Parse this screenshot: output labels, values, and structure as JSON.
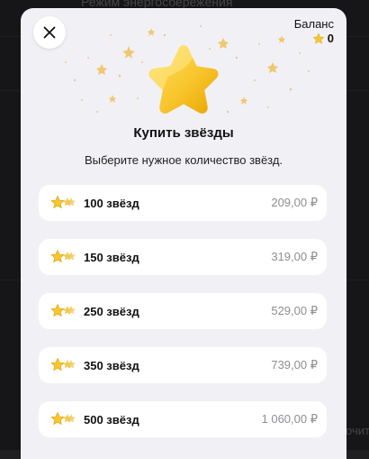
{
  "background": {
    "top_text": "Режим энергосбережения",
    "right_text": "очит"
  },
  "dialog": {
    "close_icon": "close-icon",
    "balance_label": "Баланс",
    "balance_value": "0",
    "title": "Купить звёзды",
    "subtitle": "Выберите нужное количество звёзд."
  },
  "options": [
    {
      "label": "100 звёзд",
      "price": "209,00 ₽"
    },
    {
      "label": "150 звёзд",
      "price": "319,00 ₽"
    },
    {
      "label": "250 звёзд",
      "price": "529,00 ₽"
    },
    {
      "label": "350 звёзд",
      "price": "739,00 ₽"
    },
    {
      "label": "500 звёзд",
      "price": "1 060,00 ₽"
    }
  ],
  "colors": {
    "star_gold": "#f7c531",
    "sheet_bg": "#f1f1f5",
    "price_gray": "#8e8e93"
  }
}
